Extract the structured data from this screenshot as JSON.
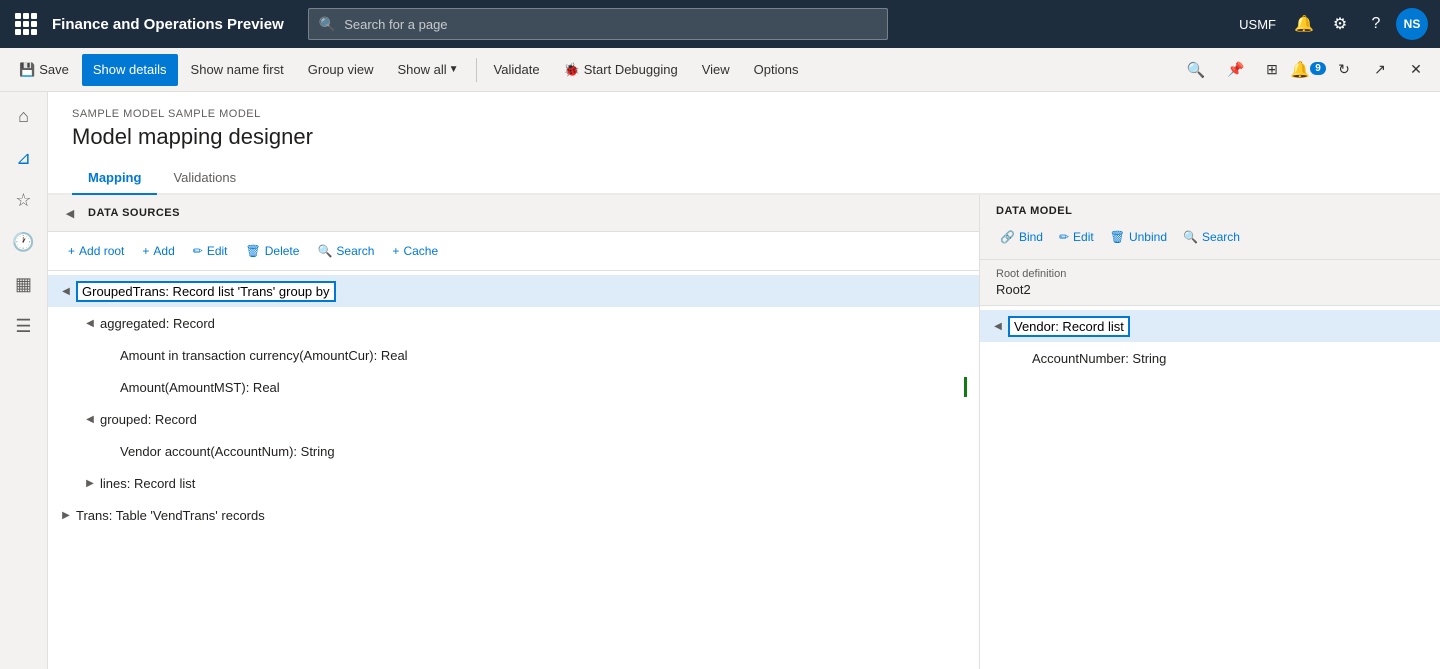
{
  "app": {
    "title": "Finance and Operations Preview",
    "search_placeholder": "Search for a page",
    "user": "USMF",
    "avatar": "NS"
  },
  "toolbar": {
    "save_label": "Save",
    "show_details_label": "Show details",
    "show_name_label": "Show name first",
    "group_view_label": "Group view",
    "show_all_label": "Show all",
    "validate_label": "Validate",
    "start_debugging_label": "Start Debugging",
    "view_label": "View",
    "options_label": "Options"
  },
  "breadcrumb": "SAMPLE MODEL SAMPLE MODEL",
  "page_title": "Model mapping designer",
  "tabs": [
    {
      "label": "Mapping",
      "active": true
    },
    {
      "label": "Validations",
      "active": false
    }
  ],
  "data_sources": {
    "panel_title": "DATA SOURCES",
    "toolbar_buttons": [
      {
        "label": "Add root",
        "icon": "+"
      },
      {
        "label": "Add",
        "icon": "+"
      },
      {
        "label": "Edit",
        "icon": "✏"
      },
      {
        "label": "Delete",
        "icon": "🗑"
      },
      {
        "label": "Search",
        "icon": "🔍"
      },
      {
        "label": "Cache",
        "icon": "+"
      }
    ],
    "tree": [
      {
        "id": "grouped-trans",
        "label": "GroupedTrans: Record list 'Trans' group by",
        "level": 0,
        "expanded": true,
        "selected": true,
        "children": [
          {
            "id": "aggregated",
            "label": "aggregated: Record",
            "level": 1,
            "expanded": true,
            "children": [
              {
                "id": "amount-cur",
                "label": "Amount in transaction currency(AmountCur): Real",
                "level": 2
              },
              {
                "id": "amount-mst",
                "label": "Amount(AmountMST): Real",
                "level": 2,
                "indicator": true
              }
            ]
          },
          {
            "id": "grouped",
            "label": "grouped: Record",
            "level": 1,
            "expanded": true,
            "children": [
              {
                "id": "vendor-account",
                "label": "Vendor account(AccountNum): String",
                "level": 2
              }
            ]
          },
          {
            "id": "lines",
            "label": "lines: Record list",
            "level": 1,
            "expanded": false
          }
        ]
      },
      {
        "id": "trans",
        "label": "Trans: Table 'VendTrans' records",
        "level": 0,
        "expanded": false
      }
    ]
  },
  "data_model": {
    "panel_title": "DATA MODEL",
    "toolbar_buttons": [
      {
        "label": "Bind",
        "icon": "🔗"
      },
      {
        "label": "Edit",
        "icon": "✏"
      },
      {
        "label": "Unbind",
        "icon": "🗑"
      },
      {
        "label": "Search",
        "icon": "🔍"
      }
    ],
    "root_definition_label": "Root definition",
    "root_definition_value": "Root2",
    "tree": [
      {
        "id": "vendor",
        "label": "Vendor: Record list",
        "level": 0,
        "expanded": true,
        "selected": true,
        "children": [
          {
            "id": "account-number",
            "label": "AccountNumber: String",
            "level": 1
          }
        ]
      }
    ]
  }
}
